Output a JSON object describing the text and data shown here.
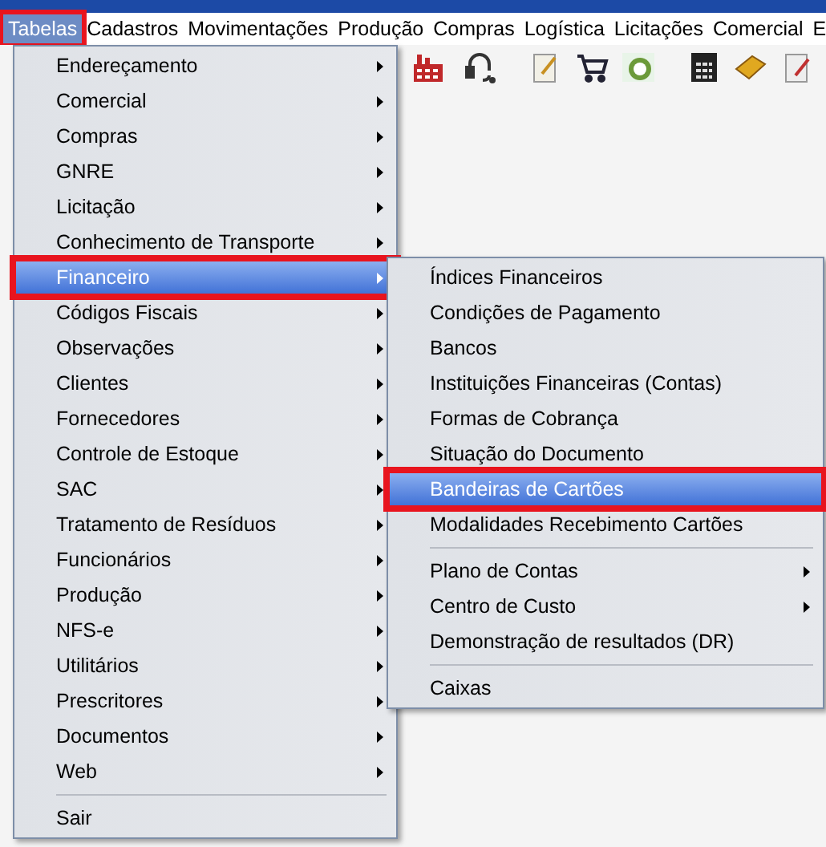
{
  "menubar": [
    {
      "label": "Tabelas",
      "selected": true,
      "annotated": true
    },
    {
      "label": "Cadastros",
      "selected": false,
      "annotated": false
    },
    {
      "label": "Movimentações",
      "selected": false,
      "annotated": false
    },
    {
      "label": "Produção",
      "selected": false,
      "annotated": false
    },
    {
      "label": "Compras",
      "selected": false,
      "annotated": false
    },
    {
      "label": "Logística",
      "selected": false,
      "annotated": false
    },
    {
      "label": "Licitações",
      "selected": false,
      "annotated": false
    },
    {
      "label": "Comercial",
      "selected": false,
      "annotated": false
    },
    {
      "label": "E",
      "selected": false,
      "annotated": false
    }
  ],
  "menu": [
    {
      "kind": "item",
      "label": "Endereçamento",
      "submenu": true,
      "selected": false,
      "annotated": false
    },
    {
      "kind": "item",
      "label": "Comercial",
      "submenu": true,
      "selected": false,
      "annotated": false
    },
    {
      "kind": "item",
      "label": "Compras",
      "submenu": true,
      "selected": false,
      "annotated": false
    },
    {
      "kind": "item",
      "label": "GNRE",
      "submenu": true,
      "selected": false,
      "annotated": false
    },
    {
      "kind": "item",
      "label": "Licitação",
      "submenu": true,
      "selected": false,
      "annotated": false
    },
    {
      "kind": "item",
      "label": "Conhecimento de Transporte",
      "submenu": true,
      "selected": false,
      "annotated": false
    },
    {
      "kind": "item",
      "label": "Financeiro",
      "submenu": true,
      "selected": true,
      "annotated": true
    },
    {
      "kind": "item",
      "label": "Códigos Fiscais",
      "submenu": true,
      "selected": false,
      "annotated": false
    },
    {
      "kind": "item",
      "label": "Observações",
      "submenu": true,
      "selected": false,
      "annotated": false
    },
    {
      "kind": "item",
      "label": "Clientes",
      "submenu": true,
      "selected": false,
      "annotated": false
    },
    {
      "kind": "item",
      "label": "Fornecedores",
      "submenu": true,
      "selected": false,
      "annotated": false
    },
    {
      "kind": "item",
      "label": "Controle de Estoque",
      "submenu": true,
      "selected": false,
      "annotated": false
    },
    {
      "kind": "item",
      "label": "SAC",
      "submenu": true,
      "selected": false,
      "annotated": false
    },
    {
      "kind": "item",
      "label": "Tratamento de Resíduos",
      "submenu": true,
      "selected": false,
      "annotated": false
    },
    {
      "kind": "item",
      "label": "Funcionários",
      "submenu": true,
      "selected": false,
      "annotated": false
    },
    {
      "kind": "item",
      "label": "Produção",
      "submenu": true,
      "selected": false,
      "annotated": false
    },
    {
      "kind": "item",
      "label": "NFS-e",
      "submenu": true,
      "selected": false,
      "annotated": false
    },
    {
      "kind": "item",
      "label": "Utilitários",
      "submenu": true,
      "selected": false,
      "annotated": false
    },
    {
      "kind": "item",
      "label": "Prescritores",
      "submenu": true,
      "selected": false,
      "annotated": false
    },
    {
      "kind": "item",
      "label": "Documentos",
      "submenu": true,
      "selected": false,
      "annotated": false
    },
    {
      "kind": "item",
      "label": "Web",
      "submenu": true,
      "selected": false,
      "annotated": false
    },
    {
      "kind": "separator"
    },
    {
      "kind": "item",
      "label": "Sair",
      "submenu": false,
      "selected": false,
      "annotated": false
    }
  ],
  "submenu": [
    {
      "kind": "item",
      "label": "Índices Financeiros",
      "submenu": false,
      "selected": false,
      "annotated": false
    },
    {
      "kind": "item",
      "label": "Condições de Pagamento",
      "submenu": false,
      "selected": false,
      "annotated": false
    },
    {
      "kind": "item",
      "label": "Bancos",
      "submenu": false,
      "selected": false,
      "annotated": false
    },
    {
      "kind": "item",
      "label": "Instituições Financeiras (Contas)",
      "submenu": false,
      "selected": false,
      "annotated": false
    },
    {
      "kind": "item",
      "label": "Formas de Cobrança",
      "submenu": false,
      "selected": false,
      "annotated": false
    },
    {
      "kind": "item",
      "label": "Situação do Documento",
      "submenu": false,
      "selected": false,
      "annotated": false
    },
    {
      "kind": "item",
      "label": "Bandeiras de Cartões",
      "submenu": false,
      "selected": true,
      "annotated": true
    },
    {
      "kind": "item",
      "label": "Modalidades Recebimento Cartões",
      "submenu": false,
      "selected": false,
      "annotated": false
    },
    {
      "kind": "separator"
    },
    {
      "kind": "item",
      "label": "Plano de Contas",
      "submenu": true,
      "selected": false,
      "annotated": false
    },
    {
      "kind": "item",
      "label": "Centro de Custo",
      "submenu": true,
      "selected": false,
      "annotated": false
    },
    {
      "kind": "item",
      "label": "Demonstração de resultados (DR)",
      "submenu": false,
      "selected": false,
      "annotated": false
    },
    {
      "kind": "separator"
    },
    {
      "kind": "item",
      "label": "Caixas",
      "submenu": false,
      "selected": false,
      "annotated": false
    }
  ]
}
